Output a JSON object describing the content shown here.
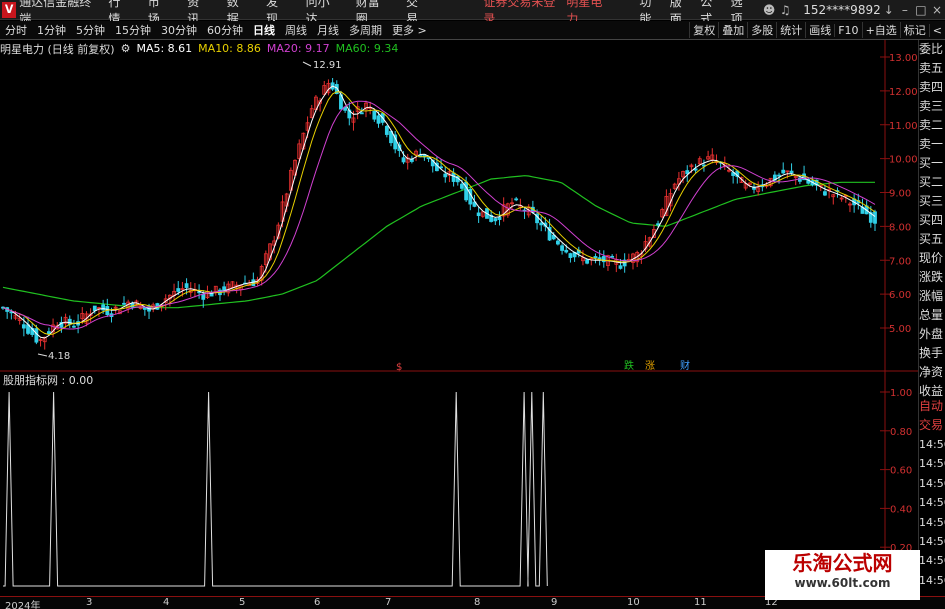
{
  "titlebar": {
    "logo_glyph": "ᐯ",
    "app_title": "通达信金融终端",
    "menus": [
      "行情",
      "市场",
      "资讯",
      "数据",
      "发现",
      "问小达",
      "财富圈",
      "交易"
    ],
    "login_status": "证券交易未登录",
    "stock_name": "明星电力",
    "right_menus": [
      "功能",
      "版面",
      "公式",
      "选项"
    ],
    "user": "152****9892",
    "window_buttons": [
      "↓",
      "–",
      "□",
      "×"
    ]
  },
  "toolbar": {
    "periods": [
      "分时",
      "1分钟",
      "5分钟",
      "15分钟",
      "30分钟",
      "60分钟",
      "日线",
      "周线",
      "月线",
      "多周期",
      "更多 >"
    ],
    "active_period": "日线",
    "right_tools": [
      "复权",
      "叠加",
      "多股",
      "统计",
      "画线",
      "F10",
      "+自选",
      "标记",
      "<"
    ]
  },
  "info": {
    "title": "明星电力 (日线 前复权)",
    "ma5": "MA5: 8.61",
    "ma10": "MA10: 8.86",
    "ma20": "MA20: 9.17",
    "ma60": "MA60: 9.34",
    "colors": {
      "ma5": "#ffffff",
      "ma10": "#e8d000",
      "ma20": "#d040d0",
      "ma60": "#20c020"
    }
  },
  "price_axis": {
    "ticks": [
      "13.00",
      "12.00",
      "11.00",
      "10.00",
      "9.00",
      "8.00",
      "7.00",
      "6.00",
      "5.00"
    ],
    "max_label": "12.91",
    "min_label": "4.18"
  },
  "markers": {
    "s_mark": "$",
    "event1": "跌",
    "event2": "涨",
    "event3": "财"
  },
  "indicator": {
    "title": "股朋指标网 : 0.00",
    "ticks": [
      "1.00",
      "0.80",
      "0.60",
      "0.40",
      "0.20"
    ]
  },
  "xaxis": {
    "labels": [
      "2024年",
      "3",
      "4",
      "5",
      "6",
      "7",
      "8",
      "9",
      "10",
      "11",
      "12"
    ]
  },
  "right_panel": {
    "items": [
      "委比",
      "卖五",
      "卖四",
      "卖三",
      "卖二",
      "卖一",
      "买一",
      "买二",
      "买三",
      "买四",
      "买五",
      "现价",
      "涨跌",
      "涨幅",
      "总量",
      "外盘",
      "换手",
      "净资",
      "收益",
      "自动",
      "交易"
    ],
    "times": [
      "14:56",
      "14:56",
      "14:56",
      "14:56",
      "14:56",
      "14:56",
      "14:56",
      "14:56"
    ]
  },
  "watermark": {
    "title": "乐淘公式网",
    "url": "www.60lt.com"
  },
  "chart_data": [
    {
      "type": "candlestick",
      "title": "明星电力 (日线 前复权)",
      "ylim": [
        4.0,
        13.3
      ],
      "x_labels": [
        "2024年",
        "3",
        "4",
        "5",
        "6",
        "7",
        "8",
        "9",
        "10",
        "11",
        "12"
      ],
      "close_path": [
        5.6,
        5.2,
        4.6,
        5.2,
        5.1,
        5.6,
        5.5,
        5.8,
        5.5,
        5.9,
        6.2,
        6.0,
        6.1,
        6.3,
        6.4,
        7.8,
        9.8,
        11.5,
        12.3,
        11.2,
        11.6,
        11.0,
        9.9,
        10.2,
        9.6,
        9.4,
        8.5,
        8.2,
        8.7,
        8.4,
        7.8,
        7.3,
        7.0,
        7.0,
        6.9,
        7.2,
        8.1,
        9.3,
        9.8,
        10.0,
        9.6,
        9.1,
        9.3,
        9.6,
        9.4,
        9.1,
        8.9,
        8.6,
        8.2
      ],
      "ma60_path": [
        6.2,
        6.0,
        5.8,
        5.7,
        5.6,
        5.6,
        5.7,
        5.8,
        6.0,
        6.4,
        7.2,
        8.0,
        8.6,
        9.0,
        9.4,
        9.5,
        9.3,
        8.6,
        8.1,
        8.0,
        8.4,
        8.8,
        9.0,
        9.2,
        9.3,
        9.3
      ],
      "series": [
        {
          "name": "MA5",
          "value": 8.61
        },
        {
          "name": "MA10",
          "value": 8.86
        },
        {
          "name": "MA20",
          "value": 9.17
        },
        {
          "name": "MA60",
          "value": 9.34
        }
      ],
      "high": 12.91,
      "low": 4.18
    },
    {
      "type": "line",
      "title": "股朋指标网",
      "ylim": [
        0,
        1
      ],
      "value": 0.0,
      "spikes_at_month_fraction": [
        0.05,
        0.6,
        2.6,
        5.8,
        6.65,
        6.75,
        6.9,
        11.45
      ],
      "spike_value": 1.0
    }
  ]
}
